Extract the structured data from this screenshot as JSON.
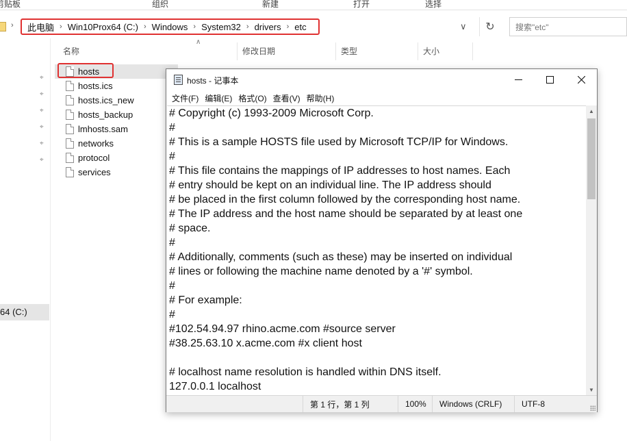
{
  "explorer": {
    "ribbon": {
      "clipboard": "剪贴板",
      "organize": "组织",
      "new": "新建",
      "open": "打开",
      "select": "选择"
    },
    "breadcrumb": [
      "此电脑",
      "Win10Prox64 (C:)",
      "Windows",
      "System32",
      "drivers",
      "etc"
    ],
    "search_placeholder": "搜索\"etc\"",
    "columns": {
      "name": "名称",
      "modified": "修改日期",
      "type": "类型",
      "size": "大小"
    },
    "nav_selected": "64 (C:)",
    "files": [
      "hosts",
      "hosts.ics",
      "hosts.ics_new",
      "hosts_backup",
      "lmhosts.sam",
      "networks",
      "protocol",
      "services"
    ]
  },
  "notepad": {
    "title": "hosts - 记事本",
    "menu": [
      "文件(F)",
      "编辑(E)",
      "格式(O)",
      "查看(V)",
      "帮助(H)"
    ],
    "lines": [
      "# Copyright (c) 1993-2009 Microsoft Corp.",
      "#",
      "# This is a sample HOSTS file used by Microsoft TCP/IP for Windows.",
      "#",
      "# This file contains the mappings of IP addresses to host names. Each",
      "# entry should be kept on an individual line. The IP address should",
      "# be placed in the first column followed by the corresponding host name.",
      "# The IP address and the host name should be separated by at least one",
      "# space.",
      "#",
      "# Additionally, comments (such as these) may be inserted on individual",
      "# lines or following the machine name denoted by a '#' symbol.",
      "#",
      "# For example:",
      "#",
      "#102.54.94.97 rhino.acme.com #source server",
      "#38.25.63.10 x.acme.com #x client host",
      "",
      "# localhost name resolution is handled within DNS itself.",
      "127.0.0.1 localhost"
    ],
    "status": {
      "position": "第 1 行，第 1 列",
      "zoom": "100%",
      "eol": "Windows (CRLF)",
      "encoding": "UTF-8"
    }
  },
  "colors": {
    "highlight_border": "#e03131",
    "selection": "#e5e5e5"
  }
}
